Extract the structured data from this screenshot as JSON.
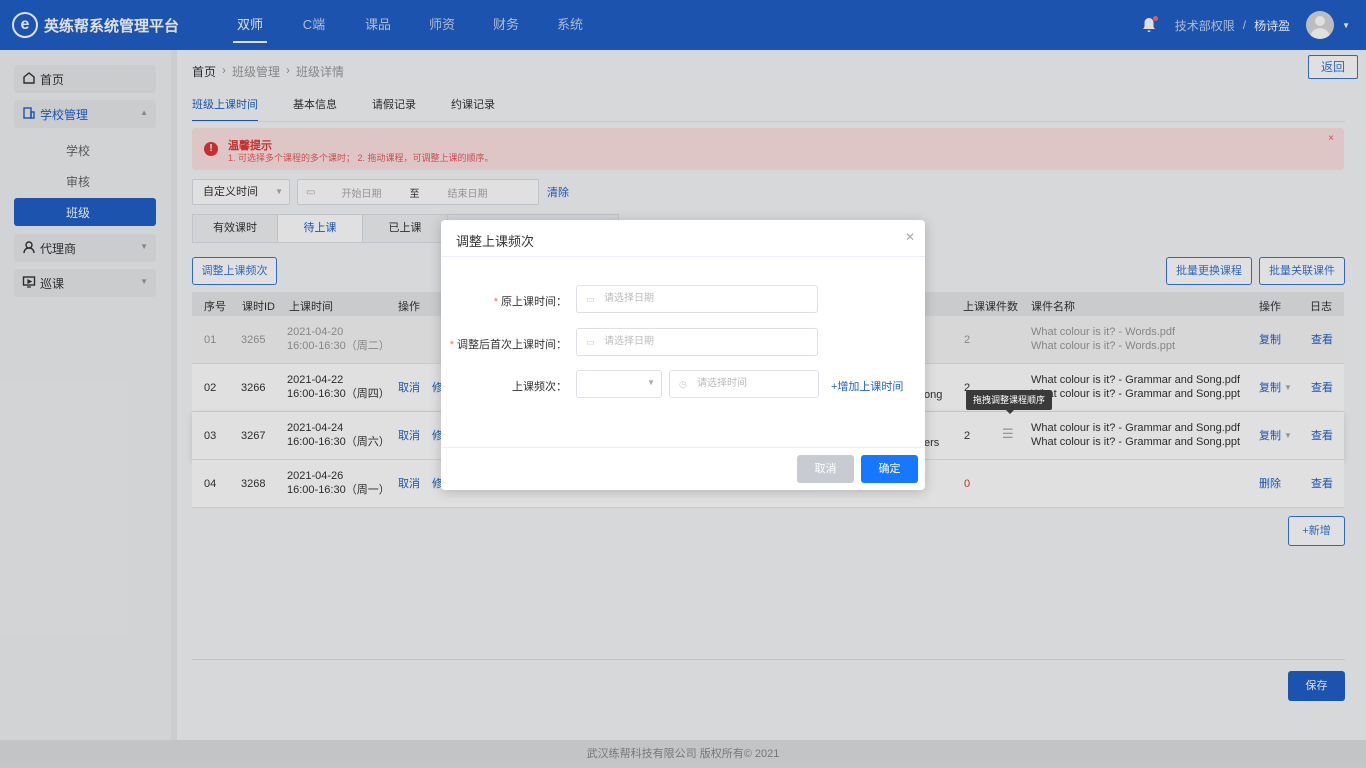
{
  "app": {
    "title": "英练帮系统管理平台",
    "logo_letter": "e"
  },
  "nav": {
    "items": [
      "双师",
      "C端",
      "课品",
      "师资",
      "财务",
      "系统"
    ],
    "active": 0
  },
  "user": {
    "role": "技术部权限",
    "separator": "/",
    "name": "杨诗盈"
  },
  "sidebar": {
    "home": "首页",
    "school_mgmt": "学校管理",
    "sub_items": [
      "学校",
      "审核",
      "班级"
    ],
    "agent": "代理商",
    "patrol": "巡课"
  },
  "breadcrumb": [
    "首页",
    "班级管理",
    "班级详情"
  ],
  "back_label": "返回",
  "tabs": [
    "班级上课时间",
    "基本信息",
    "请假记录",
    "约课记录"
  ],
  "alert": {
    "title": "温馨提示",
    "desc": "1. 可选择多个课程的多个课时；   2. 拖动课程，可调整上课的顺序。"
  },
  "filter": {
    "select_value": "自定义时间",
    "start_placeholder": "开始日期",
    "separator": "至",
    "end_placeholder": "结束日期",
    "clear": "清除"
  },
  "status_tabs": [
    "有效课时",
    "待上课",
    "已上课"
  ],
  "buttons": {
    "adjust_freq": "调整上课频次",
    "batch_replace": "批量更换课程",
    "batch_link": "批量关联课件",
    "add": "+新增",
    "save": "保存"
  },
  "table": {
    "headers_left": [
      "序号",
      "课时ID",
      "上课时间",
      "操作"
    ],
    "headers_right": [
      "上课课件数",
      "课件名称",
      "操作",
      "日志"
    ],
    "rows": [
      {
        "no": "01",
        "id": "3265",
        "date": "2021-04-20",
        "time": "16:00-16:30（周二）",
        "actions": [],
        "course_tail": "",
        "count": "2",
        "files": [
          "What colour is it? - Words.pdf",
          "What colour is it? - Words.ppt"
        ],
        "op": "复制",
        "log": "查看"
      },
      {
        "no": "02",
        "id": "3266",
        "date": "2021-04-22",
        "time": "16:00-16:30（周四）",
        "actions": [
          "取消",
          "修"
        ],
        "course_tail": "ong",
        "count": "2",
        "files": [
          "What colour is it? - Grammar and Song.pdf",
          "What colour is it? - Grammar and Song.ppt"
        ],
        "op": "复制",
        "log": "查看"
      },
      {
        "no": "03",
        "id": "3267",
        "date": "2021-04-24",
        "time": "16:00-16:30（周六）",
        "actions": [
          "取消",
          "修"
        ],
        "course_tail": "ers",
        "count": "2",
        "files": [
          "What colour is it? - Grammar and Song.pdf",
          "What colour is it? - Grammar and Song.ppt"
        ],
        "op": "复制",
        "log": "查看"
      },
      {
        "no": "04",
        "id": "3268",
        "date": "2021-04-26",
        "time": "16:00-16:30（周一）",
        "actions": [
          "取消",
          "修"
        ],
        "course_tail": "",
        "count": "0",
        "files": [],
        "op": "删除",
        "log": "查看"
      }
    ]
  },
  "tooltip": "拖拽调整课程顺序",
  "copyright": "武汉练帮科技有限公司 版权所有© 2021",
  "modal": {
    "title": "调整上课频次",
    "label_orig": "原上课时间：",
    "label_first": "调整后首次上课时间：",
    "label_freq": "上课频次：",
    "date_placeholder": "请选择日期",
    "time_placeholder": "请选择时间",
    "add_time": "+增加上课时间",
    "cancel": "取消",
    "confirm": "确定"
  },
  "colors": {
    "primary": "#1f5fc7",
    "danger": "#e03636"
  }
}
